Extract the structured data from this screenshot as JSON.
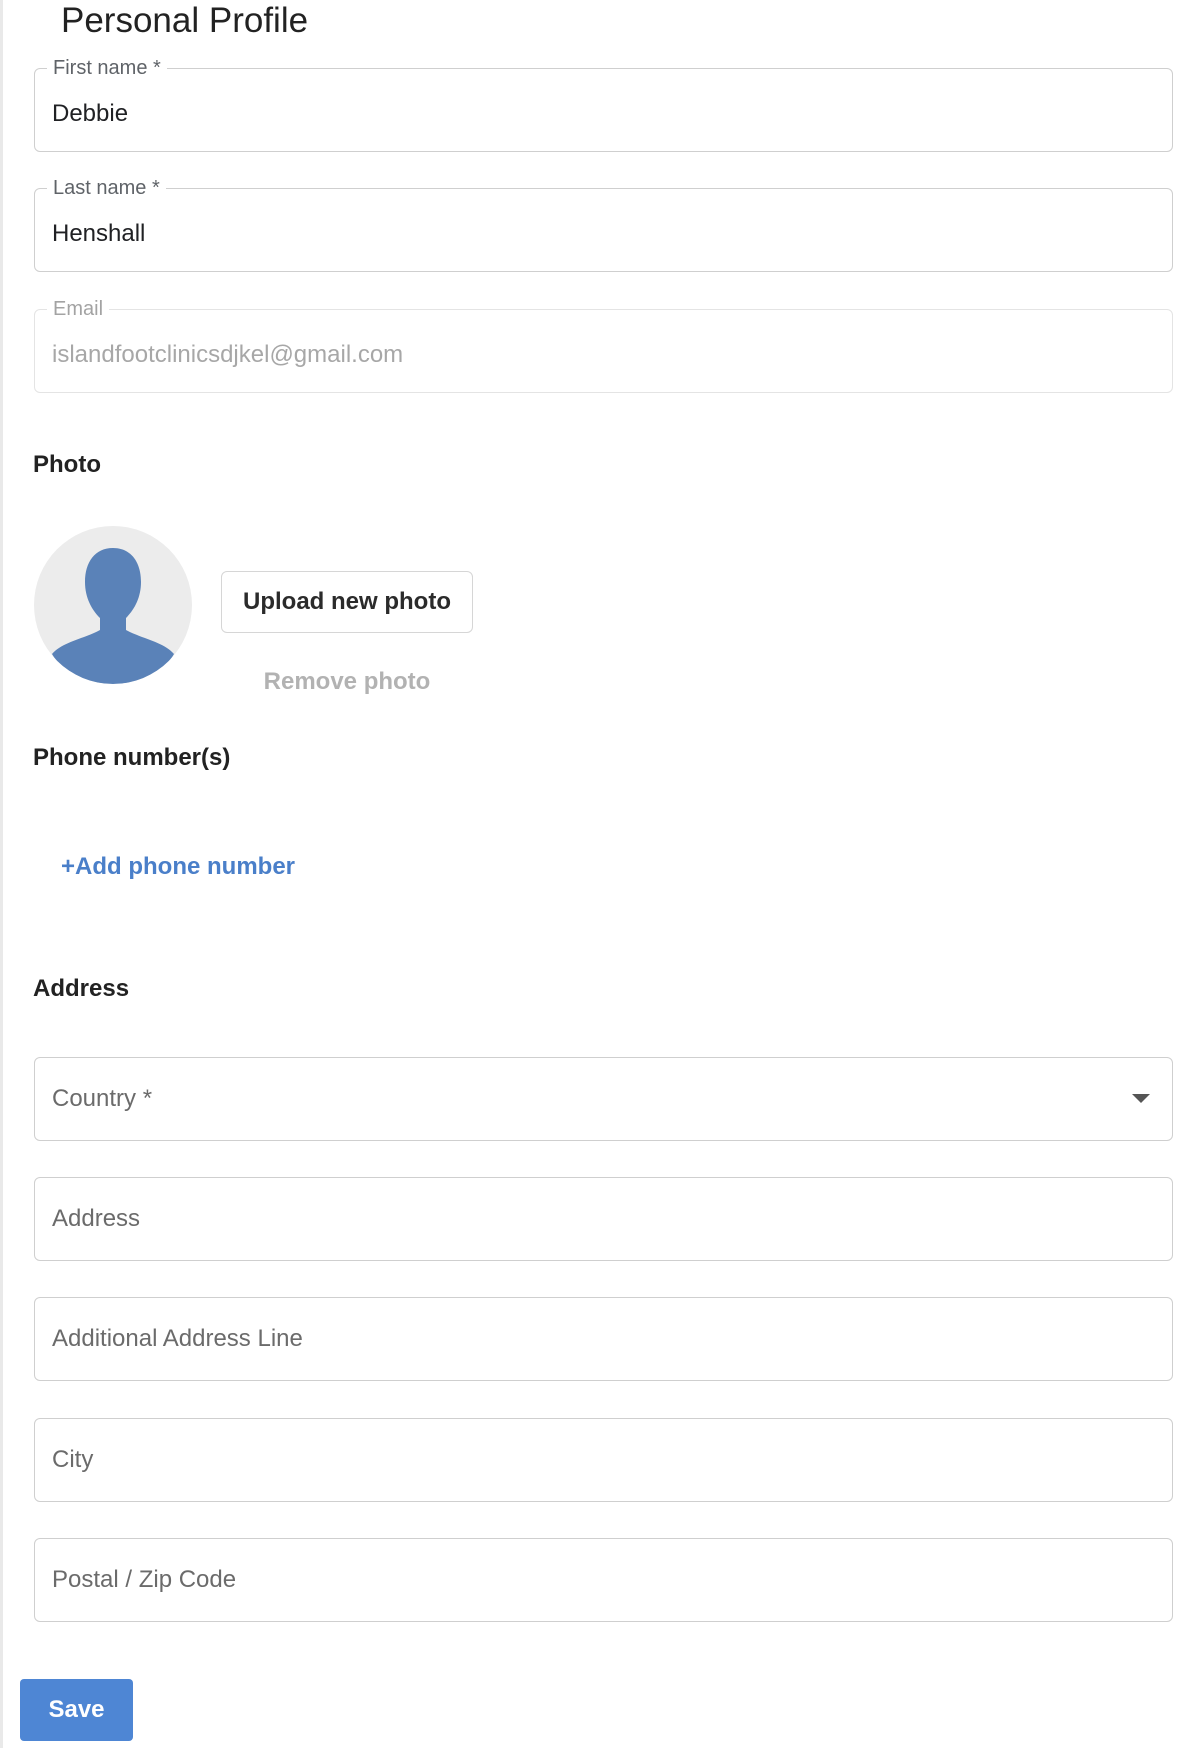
{
  "page": {
    "title": "Personal Profile"
  },
  "profile": {
    "first_name": {
      "label": "First name *",
      "value": "Debbie"
    },
    "last_name": {
      "label": "Last name *",
      "value": "Henshall"
    },
    "email": {
      "label": "Email",
      "value": "islandfootclinicsdjkel@gmail.com"
    }
  },
  "photo": {
    "section_label": "Photo",
    "avatar_icon": "person-silhouette-icon",
    "upload_label": "Upload new photo",
    "remove_label": "Remove photo"
  },
  "phone": {
    "section_label": "Phone number(s)",
    "add_label": "+Add phone number"
  },
  "address": {
    "section_label": "Address",
    "country_placeholder": "Country *",
    "address_placeholder": "Address",
    "additional_placeholder": "Additional Address Line",
    "city_placeholder": "City",
    "postal_placeholder": "Postal / Zip Code"
  },
  "actions": {
    "save_label": "Save"
  },
  "colors": {
    "primary": "#4e86d4",
    "link": "#4a7fc9",
    "avatar_figure": "#5a82b8",
    "avatar_bg": "#ececec"
  }
}
